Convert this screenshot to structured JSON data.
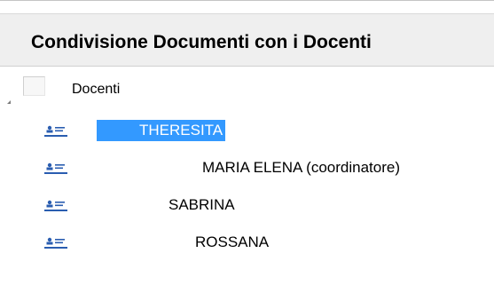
{
  "panel": {
    "title": "Condivisione Documenti con i Docenti"
  },
  "tree": {
    "root": {
      "label": "Docenti",
      "icon": "folder-icon",
      "expanded": true
    },
    "items": [
      {
        "label": "THERESITA",
        "icon": "user-card-icon",
        "selected": true
      },
      {
        "label": "MARIA ELENA (coordinatore)",
        "icon": "user-card-icon",
        "selected": false
      },
      {
        "label": "SABRINA",
        "icon": "user-card-icon",
        "selected": false
      },
      {
        "label": "ROSSANA",
        "icon": "user-card-icon",
        "selected": false
      }
    ]
  },
  "colors": {
    "selection": "#3399ff",
    "header_bg": "#efefef",
    "icon_blue": "#2a5db0"
  }
}
